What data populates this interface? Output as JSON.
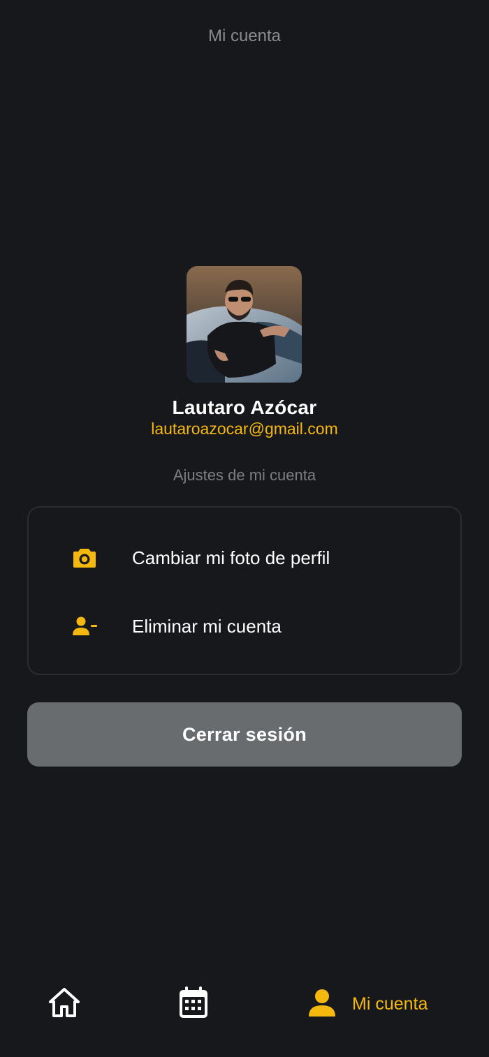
{
  "header": {
    "title": "Mi cuenta"
  },
  "profile": {
    "name": "Lautaro Azócar",
    "email": "lautaroazocar@gmail.com"
  },
  "settings": {
    "section_label": "Ajustes de mi cuenta",
    "items": [
      {
        "label": "Cambiar mi foto de perfil",
        "icon": "camera-icon"
      },
      {
        "label": "Eliminar mi cuenta",
        "icon": "person-remove-icon"
      }
    ]
  },
  "logout": {
    "label": "Cerrar sesión"
  },
  "bottom_nav": {
    "items": [
      {
        "icon": "home-icon",
        "label": ""
      },
      {
        "icon": "calendar-icon",
        "label": ""
      },
      {
        "icon": "person-icon",
        "label": "Mi cuenta",
        "active": true
      }
    ]
  },
  "colors": {
    "background": "#17181c",
    "accent": "#f5b80f",
    "button": "#686c6f",
    "muted_text": "#8a8b8f"
  }
}
